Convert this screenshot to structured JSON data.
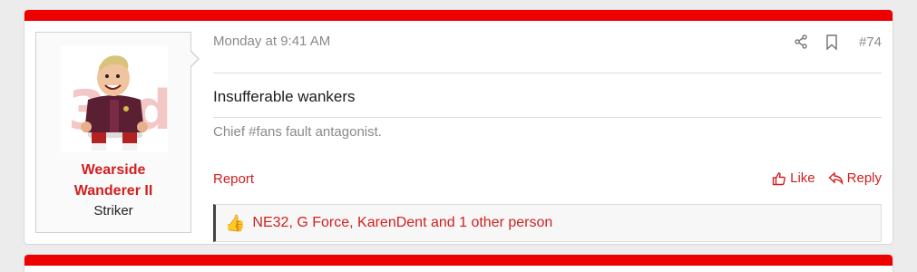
{
  "post": {
    "user": {
      "name": "Wearside Wanderer II",
      "title": "Striker"
    },
    "date": "Monday at 9:41 AM",
    "number": "#74",
    "body": "Insufferable wankers",
    "signature": "Chief #fans fault antagonist.",
    "report_label": "Report",
    "like_label": "Like",
    "reply_label": "Reply",
    "reactions_text": "NE32, G Force, KarenDent and 1 other person",
    "icons": {
      "share": "share-icon",
      "bookmark": "bookmark-icon",
      "like": "thumbs-up-icon",
      "reply": "reply-icon",
      "reaction": "thumbs-up-emoji-icon"
    }
  },
  "colors": {
    "accent_red": "#ee0000",
    "link_red": "#d21f1f",
    "muted_text": "#8a8a8a"
  }
}
